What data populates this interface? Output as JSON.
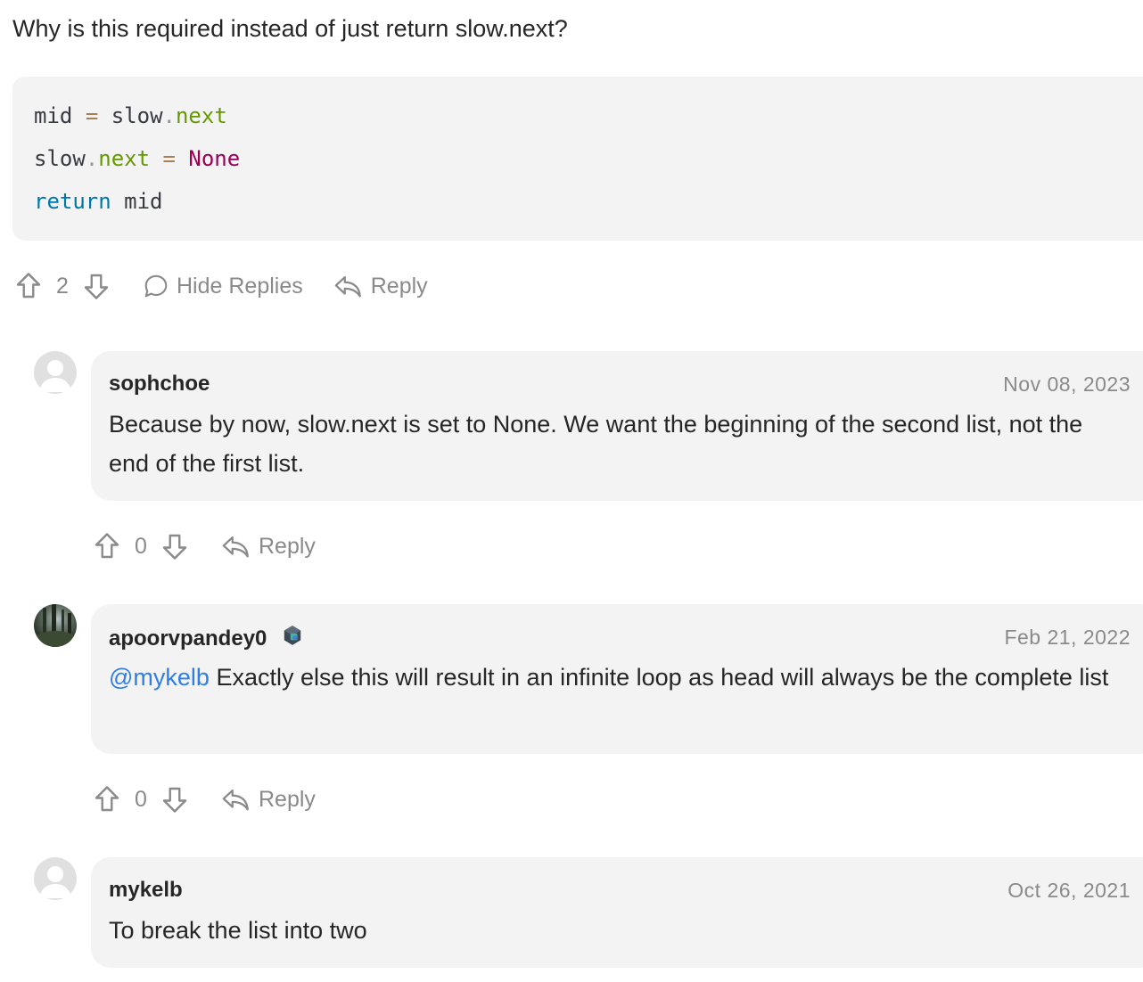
{
  "question": "Why is this required instead of just return slow.next?",
  "code_lines": {
    "l1": {
      "a": "mid",
      "b": " ",
      "c": "=",
      "d": " slow",
      "e": ".",
      "f": "next"
    },
    "l2": {
      "a": "slow",
      "b": ".",
      "c": "next",
      "d": " ",
      "e": "=",
      "f": " ",
      "g": "None"
    },
    "l3": {
      "a": "return",
      "b": " mid"
    }
  },
  "top_actions": {
    "vote_count": "2",
    "hide_replies_label": "Hide Replies",
    "reply_label": "Reply"
  },
  "replies": [
    {
      "username": "sophchoe",
      "date": "Nov 08, 2023",
      "body": "Because by now, slow.next is set to None. We want the beginning of the second list, not the end of the first list.",
      "vote_count": "0",
      "reply_label": "Reply",
      "avatar": "default-avatar-icon"
    },
    {
      "username": "apoorvpandey0",
      "date": "Feb 21, 2022",
      "mention": "@mykelb",
      "body": " Exactly else this will result in an infinite loop as head will always be the complete list",
      "vote_count": "0",
      "reply_label": "Reply",
      "avatar": "forest-photo"
    },
    {
      "username": "mykelb",
      "date": "Oct 26, 2021",
      "body": "To break the list into two",
      "avatar": "default-avatar-icon"
    }
  ],
  "colors": {
    "card_bg": "#f3f3f3",
    "mention": "#2f7ee8",
    "muted": "#8a8a8a",
    "keyword": "#0077aa",
    "attribute": "#669900",
    "constant": "#990055"
  }
}
